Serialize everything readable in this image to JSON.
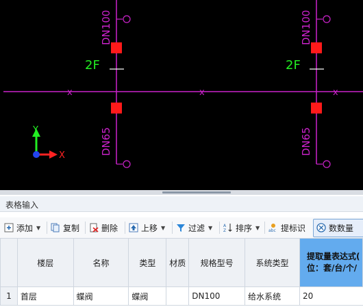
{
  "cad": {
    "background": "#000000",
    "pipe_color": "#cc22cc",
    "valve_color": "#ff1a1a",
    "floor_color": "#22ee22",
    "label_color": "#cc22cc",
    "pipe_upper_label": "DN100",
    "pipe_lower_label": "DN65",
    "floor_label": "2F",
    "cross_label": "x",
    "axis_y_label": "Y",
    "axis_x_label": "X"
  },
  "panel": {
    "title": "表格输入"
  },
  "toolbar": {
    "add": "添加",
    "copy": "复制",
    "delete": "删除",
    "move_up": "上移",
    "filter": "过滤",
    "sort": "排序",
    "identify": "提标识",
    "count": "数数量"
  },
  "table": {
    "headers": {
      "floor": "楼层",
      "name": "名称",
      "type": "类型",
      "material": "材质",
      "spec": "规格型号",
      "system": "系统类型",
      "expr_line1": "提取量表达式(",
      "expr_line2": "位：套/台/个/"
    },
    "rows": [
      {
        "no": "1",
        "floor": "首层",
        "name": "蝶阀",
        "type": "蝶阀",
        "material": "",
        "spec": "DN100",
        "system": "给水系统",
        "expr": "20"
      }
    ]
  },
  "colors": {
    "accent": "#63abee",
    "header_bg": "#eef1f5"
  }
}
